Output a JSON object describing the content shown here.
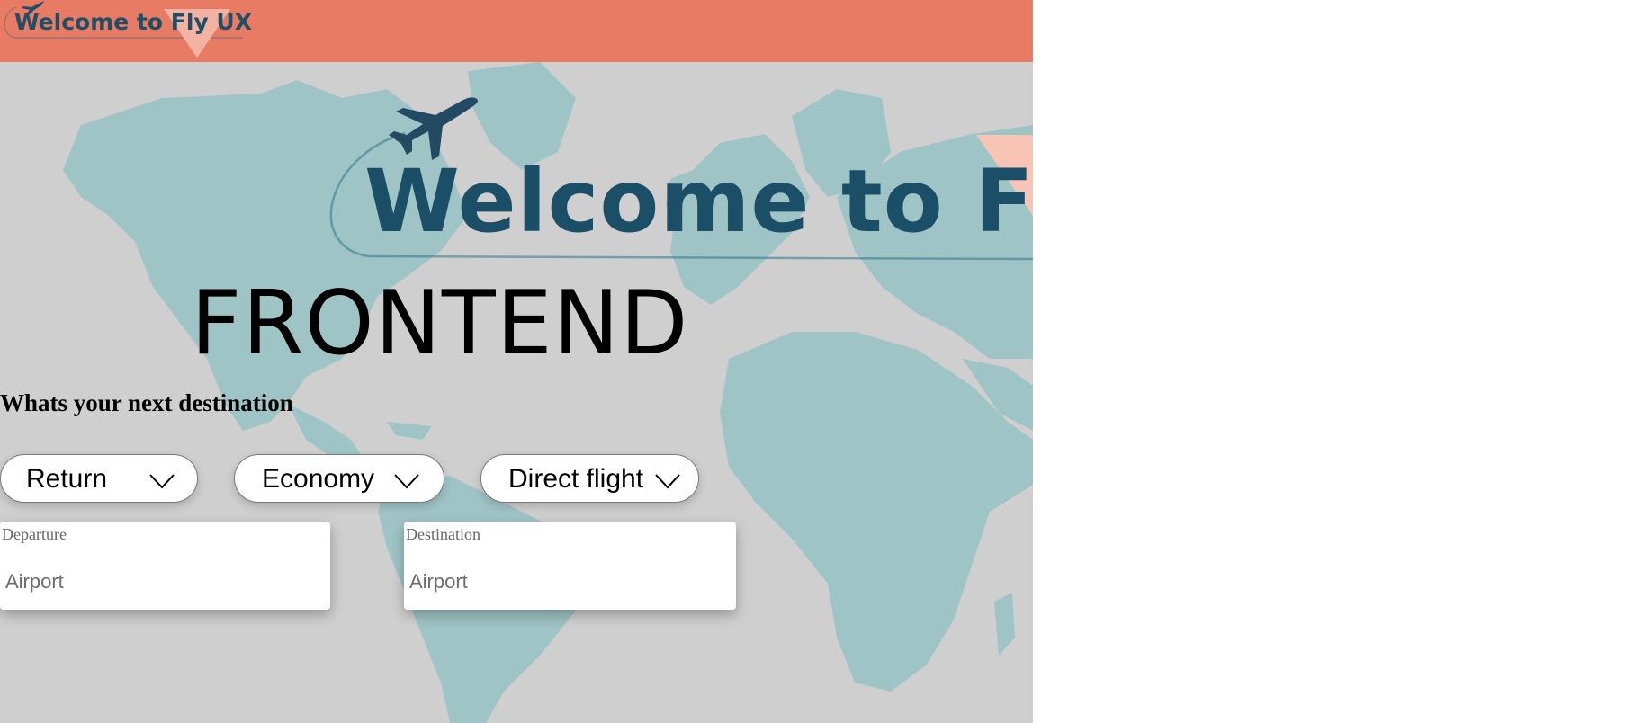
{
  "colors": {
    "header": "#e87b63",
    "brand_navy": "#1b4f68",
    "map_land": "#9fc4c6",
    "map_sea": "#cfcfcf",
    "logo_triangle": "#f4b3a2"
  },
  "header": {
    "logo_text": "Welcome to Fly UX",
    "logo_icon": "airplane-icon"
  },
  "hero": {
    "logo_text": "Welcome to Fly UX",
    "logo_icon": "airplane-icon"
  },
  "main": {
    "title": "FRONTEND",
    "subtitle": "Whats your next destination"
  },
  "filters": {
    "trip_type": {
      "value": "Return",
      "icon": "chevron-down-icon"
    },
    "cabin_class": {
      "value": "Economy",
      "icon": "chevron-down-icon"
    },
    "stops": {
      "value": "Direct flight",
      "icon": "chevron-down-icon"
    }
  },
  "departure": {
    "label": "Departure",
    "placeholder": "Airport",
    "value": ""
  },
  "destination": {
    "label": "Destination",
    "placeholder": "Airport",
    "value": ""
  }
}
